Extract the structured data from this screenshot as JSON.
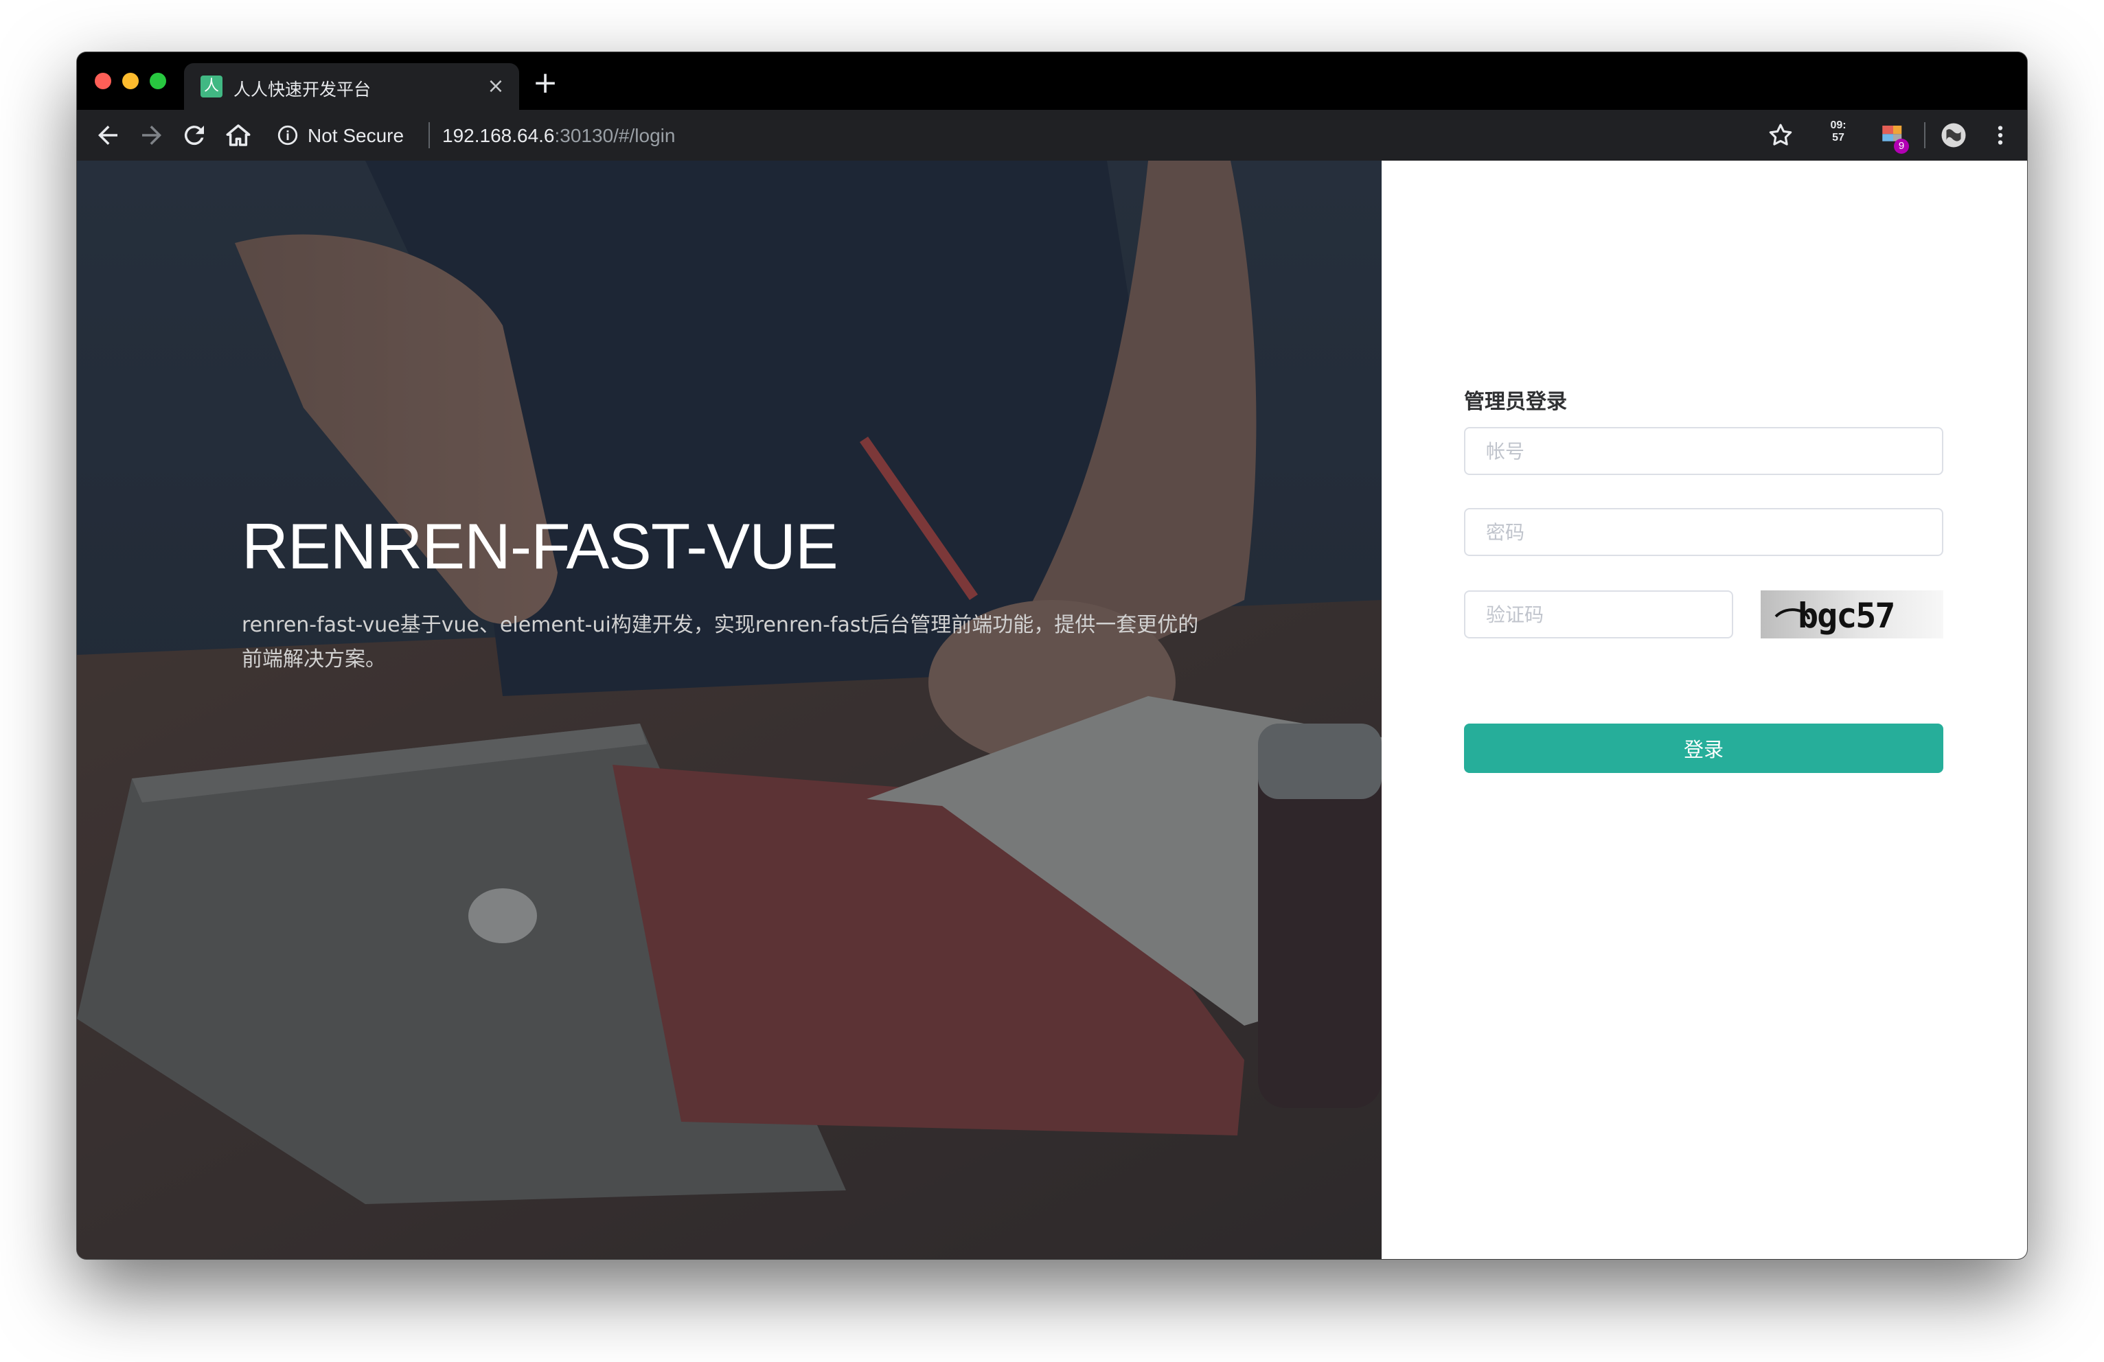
{
  "browser": {
    "tab_title": "人人快速开发平台",
    "favicon_glyph": "人",
    "tab_close": "×",
    "new_tab": "+",
    "security_label": "Not Secure",
    "url_host": "192.168.64.6",
    "url_rest": ":30130/#/login",
    "clock_ext_text": "09:\n57",
    "ext_badge": "9"
  },
  "hero": {
    "title": "RENREN-FAST-VUE",
    "description": "renren-fast-vue基于vue、element-ui构建开发，实现renren-fast后台管理前端功能，提供一套更优的前端解决方案。"
  },
  "login": {
    "title": "管理员登录",
    "username_placeholder": "帐号",
    "password_placeholder": "密码",
    "captcha_placeholder": "验证码",
    "captcha_text": "bgc57",
    "submit_label": "登录"
  },
  "colors": {
    "primary": "#26ae9a",
    "hero_overlay": "#1e2a38"
  }
}
